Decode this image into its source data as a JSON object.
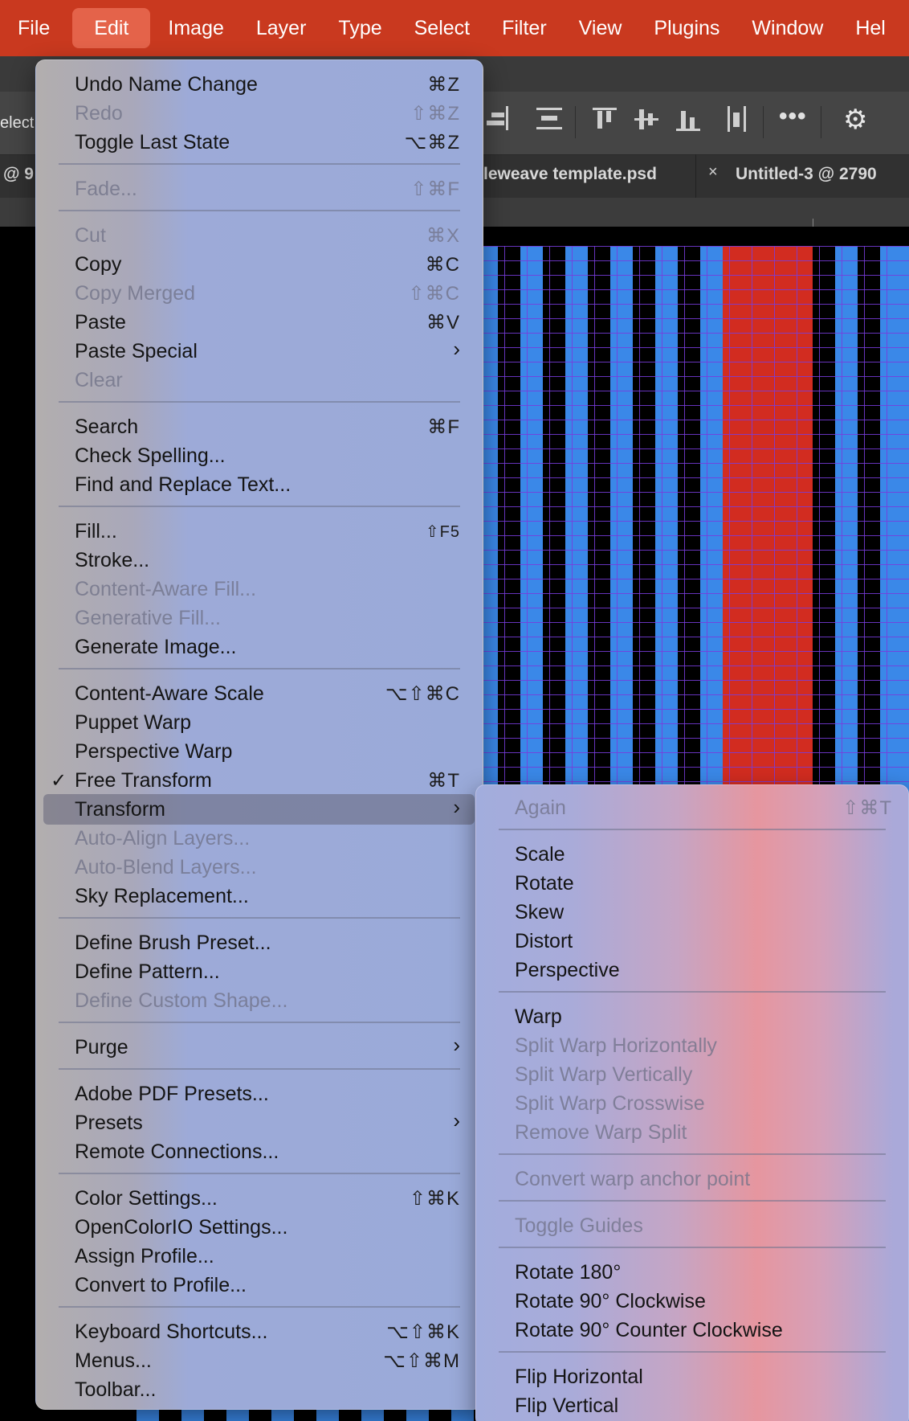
{
  "menubar": {
    "items": [
      "File",
      "Edit",
      "Image",
      "Layer",
      "Type",
      "Select",
      "Filter",
      "View",
      "Plugins",
      "Window",
      "Hel"
    ]
  },
  "options_bar": {
    "left_text": "elect"
  },
  "tabs": {
    "left_fragment": "@ 9",
    "tab2": "leweave template.psd",
    "tab3": "Untitled-3 @ 2790",
    "close_glyph": "×"
  },
  "edit_menu": {
    "items": [
      {
        "label": "Undo Name Change",
        "shortcut": "⌘Z"
      },
      {
        "label": "Redo",
        "shortcut": "⇧⌘Z"
      },
      {
        "label": "Toggle Last State",
        "shortcut": "⌥⌘Z"
      },
      {
        "label": "Fade...",
        "shortcut": "⇧⌘F"
      },
      {
        "label": "Cut",
        "shortcut": "⌘X"
      },
      {
        "label": "Copy",
        "shortcut": "⌘C"
      },
      {
        "label": "Copy Merged",
        "shortcut": "⇧⌘C"
      },
      {
        "label": "Paste",
        "shortcut": "⌘V"
      },
      {
        "label": "Paste Special",
        "shortcut": ""
      },
      {
        "label": "Clear",
        "shortcut": ""
      },
      {
        "label": "Search",
        "shortcut": "⌘F"
      },
      {
        "label": "Check Spelling...",
        "shortcut": ""
      },
      {
        "label": "Find and Replace Text...",
        "shortcut": ""
      },
      {
        "label": "Fill...",
        "shortcut": "⇧F5"
      },
      {
        "label": "Stroke...",
        "shortcut": ""
      },
      {
        "label": "Content-Aware Fill...",
        "shortcut": ""
      },
      {
        "label": "Generative Fill...",
        "shortcut": ""
      },
      {
        "label": "Generate Image...",
        "shortcut": ""
      },
      {
        "label": "Content-Aware Scale",
        "shortcut": "⌥⇧⌘C"
      },
      {
        "label": "Puppet Warp",
        "shortcut": ""
      },
      {
        "label": "Perspective Warp",
        "shortcut": ""
      },
      {
        "label": "Free Transform",
        "shortcut": "⌘T"
      },
      {
        "label": "Transform",
        "shortcut": ""
      },
      {
        "label": "Auto-Align Layers...",
        "shortcut": ""
      },
      {
        "label": "Auto-Blend Layers...",
        "shortcut": ""
      },
      {
        "label": "Sky Replacement...",
        "shortcut": ""
      },
      {
        "label": "Define Brush Preset...",
        "shortcut": ""
      },
      {
        "label": "Define Pattern...",
        "shortcut": ""
      },
      {
        "label": "Define Custom Shape...",
        "shortcut": ""
      },
      {
        "label": "Purge",
        "shortcut": ""
      },
      {
        "label": "Adobe PDF Presets...",
        "shortcut": ""
      },
      {
        "label": "Presets",
        "shortcut": ""
      },
      {
        "label": "Remote Connections...",
        "shortcut": ""
      },
      {
        "label": "Color Settings...",
        "shortcut": "⇧⌘K"
      },
      {
        "label": "OpenColorIO Settings...",
        "shortcut": ""
      },
      {
        "label": "Assign Profile...",
        "shortcut": ""
      },
      {
        "label": "Convert to Profile...",
        "shortcut": ""
      },
      {
        "label": "Keyboard Shortcuts...",
        "shortcut": "⌥⇧⌘K"
      },
      {
        "label": "Menus...",
        "shortcut": "⌥⇧⌘M"
      },
      {
        "label": "Toolbar...",
        "shortcut": ""
      }
    ],
    "check_glyph": "✓",
    "submenu_arrow": "›"
  },
  "transform_menu": {
    "items": [
      {
        "label": "Again",
        "shortcut": "⇧⌘T"
      },
      {
        "label": "Scale"
      },
      {
        "label": "Rotate"
      },
      {
        "label": "Skew"
      },
      {
        "label": "Distort"
      },
      {
        "label": "Perspective"
      },
      {
        "label": "Warp"
      },
      {
        "label": "Split Warp Horizontally"
      },
      {
        "label": "Split Warp Vertically"
      },
      {
        "label": "Split Warp Crosswise"
      },
      {
        "label": "Remove Warp Split"
      },
      {
        "label": "Convert warp anchor point"
      },
      {
        "label": "Toggle Guides"
      },
      {
        "label": "Rotate 180°"
      },
      {
        "label": "Rotate 90° Clockwise"
      },
      {
        "label": "Rotate 90° Counter Clockwise"
      },
      {
        "label": "Flip Horizontal"
      },
      {
        "label": "Flip Vertical"
      }
    ]
  },
  "colors": {
    "menubar": "#c9391f",
    "active_menu": "#e4634a",
    "pattern_blue": "#3a88e8",
    "pattern_red": "#d22c20",
    "grid_purple": "#7a3cdc"
  }
}
